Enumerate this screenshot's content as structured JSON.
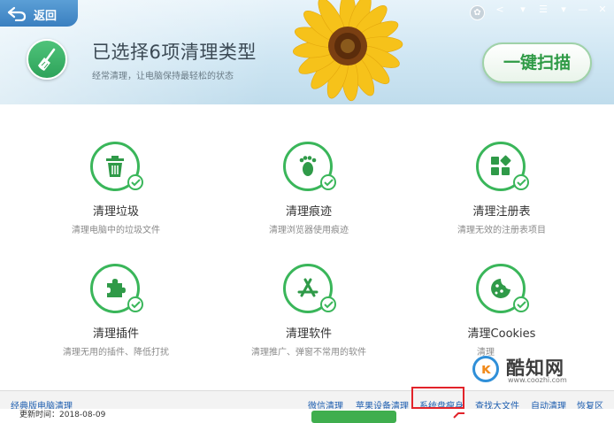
{
  "header": {
    "back_label": "返回",
    "title": "已选择6项清理类型",
    "subtitle": "经常清理，让电脑保持最轻松的状态",
    "scan_button": "一键扫描"
  },
  "items": [
    {
      "name": "清理垃圾",
      "desc": "清理电脑中的垃圾文件",
      "icon": "trash-icon"
    },
    {
      "name": "清理痕迹",
      "desc": "清理浏览器使用痕迹",
      "icon": "footprint-icon"
    },
    {
      "name": "清理注册表",
      "desc": "清理无效的注册表项目",
      "icon": "registry-icon"
    },
    {
      "name": "清理插件",
      "desc": "清理无用的插件、降低打扰",
      "icon": "puzzle-icon"
    },
    {
      "name": "清理软件",
      "desc": "清理推广、弹窗不常用的软件",
      "icon": "app-store-icon"
    },
    {
      "name": "清理Cookies",
      "desc": "清理",
      "icon": "cookie-icon"
    }
  ],
  "watermark": {
    "name": "酷知网",
    "url": "www.coozhi.com"
  },
  "bottom_bar": {
    "left": "经典版电脑清理",
    "links": [
      "微信清理",
      "苹果设备清理",
      "系统盘瘦身",
      "查找大文件",
      "自动清理",
      "恢复区"
    ]
  },
  "below": {
    "text": "更新时间：2018-08-09"
  },
  "colors": {
    "accent": "#3ab65a",
    "link": "#1f5fb0",
    "highlight": "#e2232a"
  }
}
